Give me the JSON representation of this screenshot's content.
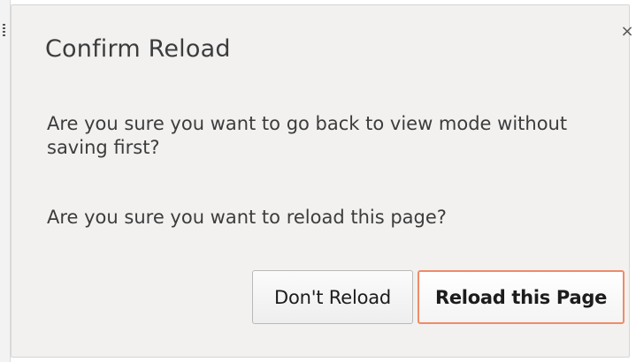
{
  "dialog": {
    "title": "Confirm Reload",
    "message": "Are you sure you want to go back to view mode without saving first?",
    "question": "Are you sure you want to reload this page?",
    "close_symbol": "×"
  },
  "buttons": {
    "secondary_label": "Don't Reload",
    "primary_label": "Reload this Page"
  },
  "colors": {
    "dialog_background": "#f2f1f0",
    "text": "#3c3c3c",
    "primary_border": "#f08b67"
  },
  "icons": {
    "close": "close-icon",
    "left_edge": "drag-handle-icon"
  }
}
